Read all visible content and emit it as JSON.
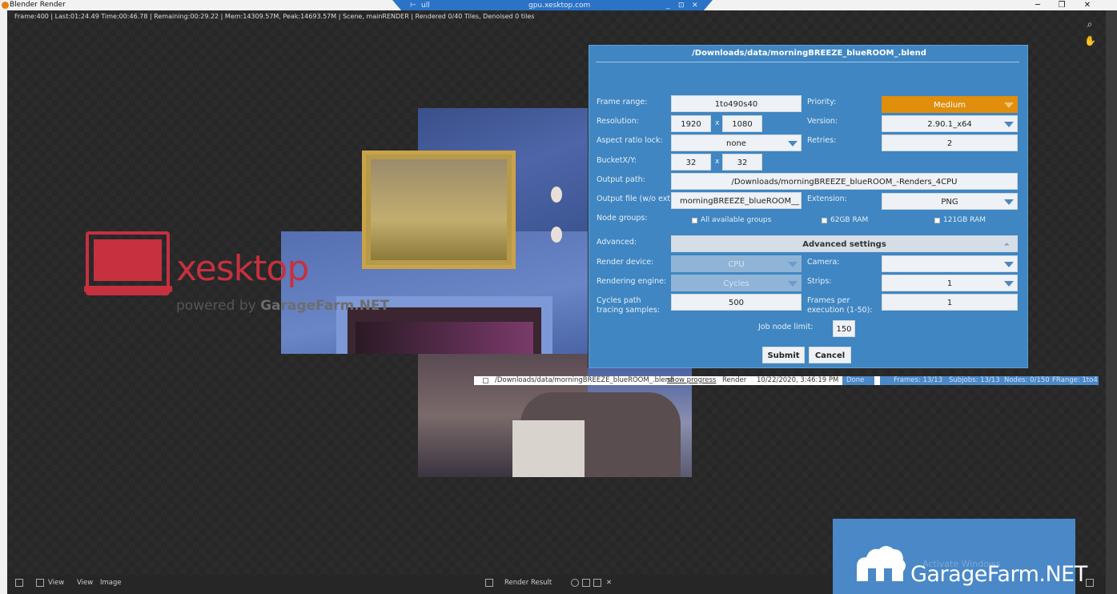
{
  "window": {
    "title": "Blender Render",
    "remote_label": "gpu.xesktop.com",
    "remote_tag": "ull",
    "minimize": "─",
    "restore": "❐",
    "close": "✕",
    "remote_min": "_",
    "remote_restore": "⊡",
    "remote_close": "✕"
  },
  "render_stats": "Frame:400 | Last:01:24.49 Time:00:46.78 | Remaining:00:29.22 | Mem:14309.57M, Peak:14693.57M | Scene, mainRENDER | Rendered 0/40 Tiles, Denoised 0 tiles",
  "viewport_icons": {
    "zoom": "⌕",
    "pan": "✋"
  },
  "logo": {
    "brand": "xesktop",
    "powered_by": "powered by",
    "partner": "GarageFarm.NET"
  },
  "dialog": {
    "title": "/Downloads/data/morningBREEZE_blueROOM_.blend",
    "frame_range_label": "Frame range:",
    "frame_range": "1to490s40",
    "priority_label": "Priority:",
    "priority": "Medium",
    "resolution_label": "Resolution:",
    "res_x": "1920",
    "res_sep": "x",
    "res_y": "1080",
    "version_label": "Version:",
    "version": "2.90.1_x64",
    "aspect_label": "Aspect ratio lock:",
    "aspect": "none",
    "retries_label": "Retries:",
    "retries": "2",
    "bucket_label": "BucketX/Y:",
    "bucket_x": "32",
    "bucket_sep": "x",
    "bucket_y": "32",
    "output_path_label": "Output path:",
    "output_path": "/Downloads/morningBREEZE_blueROOM_-Renders_4CPU",
    "output_file_label": "Output file (w/o ext):",
    "output_file": "morningBREEZE_blueROOM__",
    "extension_label": "Extension:",
    "extension": "PNG",
    "node_groups_label": "Node groups:",
    "node_groups": [
      "All available groups",
      "62GB RAM",
      "121GB RAM"
    ],
    "advanced_label": "Advanced:",
    "advanced_settings": "Advanced settings",
    "advanced_chevron": "⌃",
    "render_device_label": "Render device:",
    "render_device": "CPU",
    "camera_label": "Camera:",
    "camera": "",
    "engine_label": "Rendering engine:",
    "engine": "Cycles",
    "strips_label": "Strips:",
    "strips": "1",
    "samples_label": "Cycles path tracing samples:",
    "samples": "500",
    "frames_per_exec_label": "Frames per execution (1-50):",
    "frames_per_exec": "1",
    "job_node_limit_label": "Job node limit:",
    "job_node_limit": "150",
    "submit": "Submit",
    "cancel": "Cancel"
  },
  "job_row": {
    "file": "/Downloads/data/morningBREEZE_blueROOM_.blend",
    "show_progress": "show progress",
    "type": "Render",
    "date": "10/22/2020, 3:46:19 PM",
    "status": "Done",
    "frames": "Frames: 13/13",
    "subjobs": "Subjobs: 13/13",
    "nodes": "Nodes: 0/150",
    "frange": "FRange: 1to4"
  },
  "bottom_bar": {
    "view_menu": "View",
    "view": "View",
    "image": "Image",
    "render_result": "Render Result",
    "activate_windows": "Activate Windows"
  },
  "garagefarm": {
    "name": "GarageFarm.NET"
  },
  "colors": {
    "dialog_bg": "#3f86c2",
    "priority": "#e08e0b",
    "brand_red": "#c7303f",
    "garagefarm_blue": "#4a88c7"
  }
}
